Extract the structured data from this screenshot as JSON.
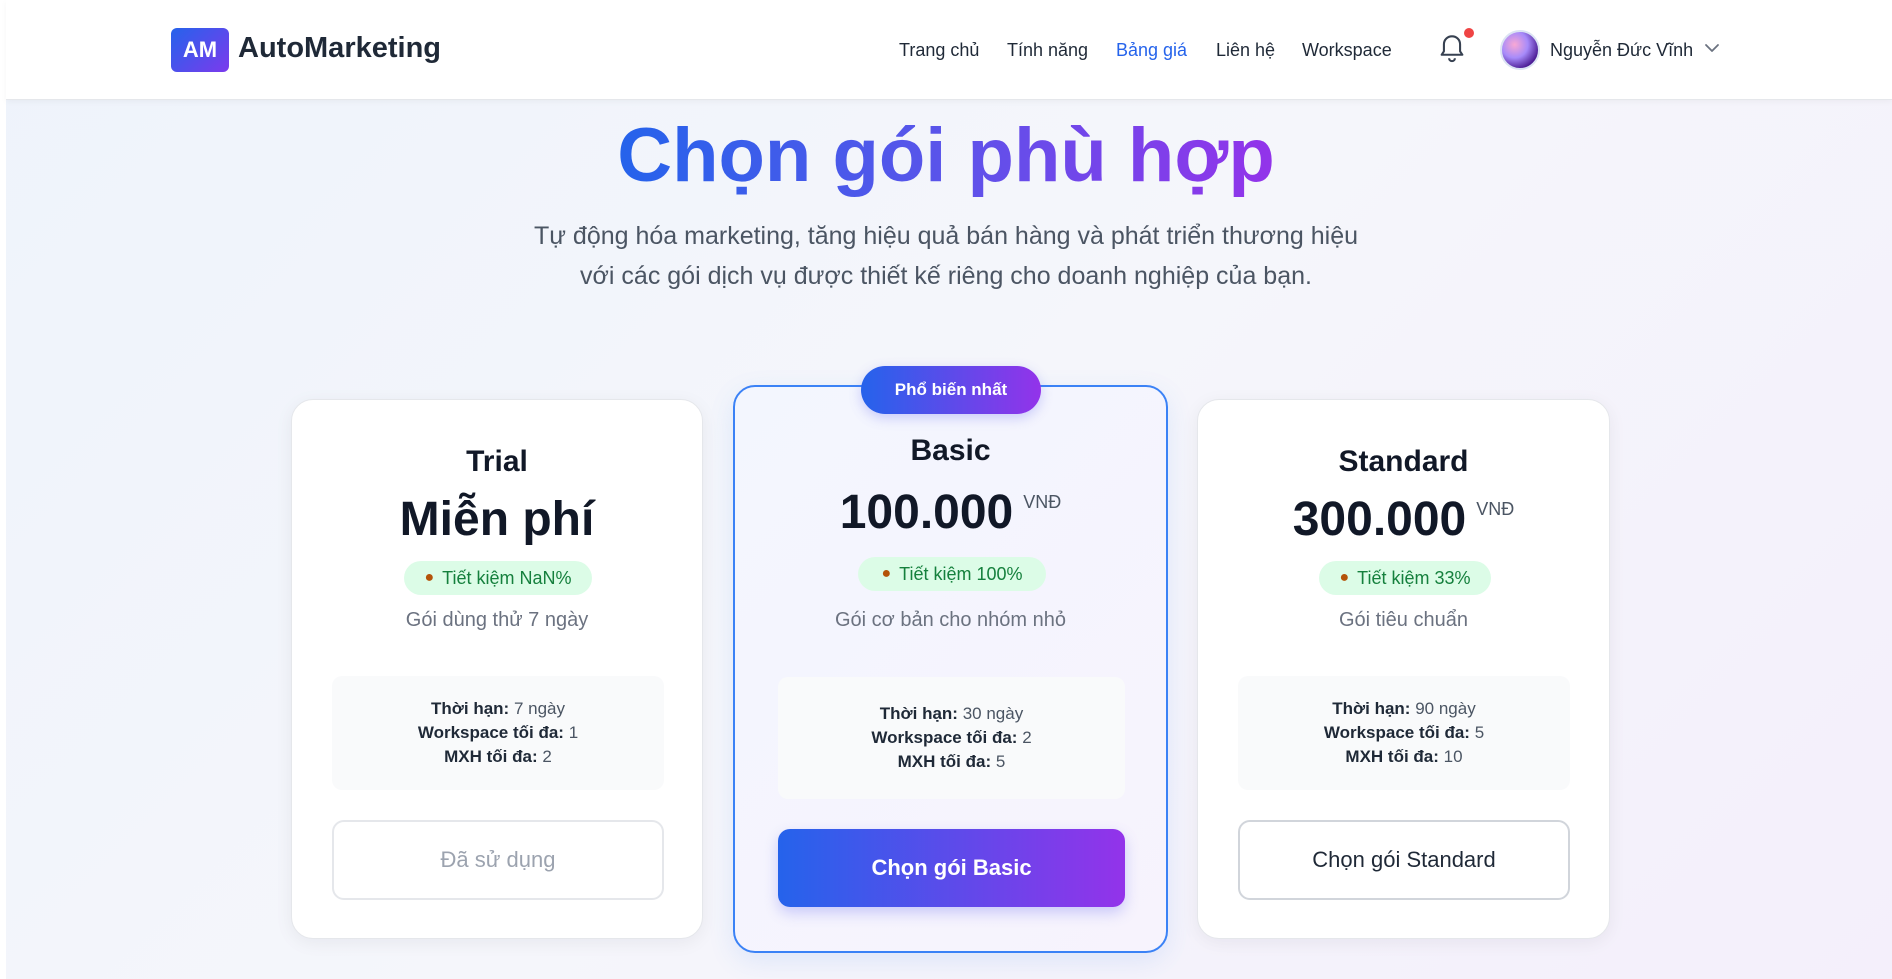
{
  "brand": {
    "logo_text": "AM",
    "name": "AutoMarketing"
  },
  "nav": {
    "items": [
      {
        "label": "Trang chủ"
      },
      {
        "label": "Tính năng"
      },
      {
        "label": "Bảng giá"
      },
      {
        "label": "Liên hệ"
      },
      {
        "label": "Workspace"
      }
    ],
    "active_item": "Bảng giá"
  },
  "user": {
    "name": "Nguyễn Đức Vĩnh",
    "has_notification": true,
    "icons": [
      "bell-icon",
      "chevron-down-icon"
    ]
  },
  "hero": {
    "title": "Chọn gói phù hợp",
    "subtitle_line1": "Tự động hóa marketing, tăng hiệu quả bán hàng và phát triển thương hiệu",
    "subtitle_line2": "với các gói dịch vụ được thiết kế riêng cho doanh nghiệp của bạn."
  },
  "plans": [
    {
      "name": "Trial",
      "price": "Miễn phí",
      "currency": "",
      "save": "Tiết kiệm NaN%",
      "description": "Gói dùng thử 7 ngày",
      "specs": [
        {
          "label": "Thời hạn:",
          "value": "7 ngày"
        },
        {
          "label": "Workspace tối đa:",
          "value": "1"
        },
        {
          "label": "MXH tối đa:",
          "value": "2"
        }
      ],
      "button": "Đã sử dụng"
    },
    {
      "name": "Basic",
      "price": "100.000",
      "currency": "VNĐ",
      "save": "Tiết kiệm 100%",
      "description": "Gói cơ bản cho nhóm nhỏ",
      "badge": "Phổ biến nhất",
      "specs": [
        {
          "label": "Thời hạn:",
          "value": "30 ngày"
        },
        {
          "label": "Workspace tối đa:",
          "value": "2"
        },
        {
          "label": "MXH tối đa:",
          "value": "5"
        }
      ],
      "button": "Chọn gói Basic"
    },
    {
      "name": "Standard",
      "price": "300.000",
      "currency": "VNĐ",
      "save": "Tiết kiệm 33%",
      "description": "Gói tiêu chuẩn",
      "specs": [
        {
          "label": "Thời hạn:",
          "value": "90 ngày"
        },
        {
          "label": "Workspace tối đa:",
          "value": "5"
        },
        {
          "label": "MXH tối đa:",
          "value": "10"
        }
      ],
      "button": "Chọn gói Standard"
    }
  ],
  "colors": {
    "accent_blue": "#2563eb",
    "accent_purple": "#9333ea",
    "save_green": "#15803d",
    "notification_red": "#ef4444"
  }
}
